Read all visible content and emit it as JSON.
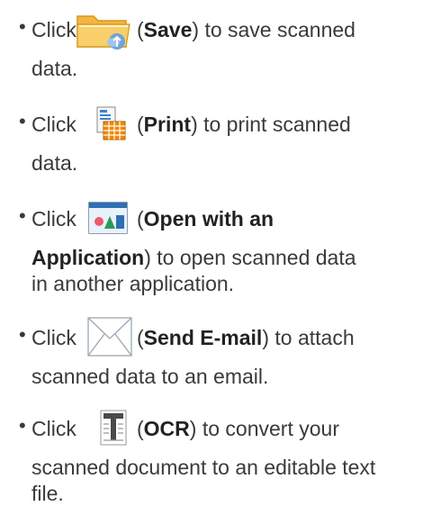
{
  "items": [
    {
      "icon": "save-folder-icon",
      "click": "Click",
      "open_paren": "(",
      "label": "Save",
      "line1_rest": ") to save scanned",
      "line2": "data."
    },
    {
      "icon": "print-icon",
      "click": "Click",
      "open_paren": "(",
      "label": "Print",
      "line1_rest": ") to print scanned",
      "line2": "data."
    },
    {
      "icon": "open-application-icon",
      "click": "Click",
      "open_paren": "(",
      "label_line1": "Open with an",
      "label_line2": "Application",
      "line2_rest": ") to open scanned data",
      "line3": "in another application."
    },
    {
      "icon": "email-envelope-icon",
      "click": "Click",
      "open_paren": "(",
      "label": "Send E-mail",
      "line1_rest": ") to attach",
      "line2": "scanned data to an email."
    },
    {
      "icon": "ocr-text-icon",
      "click": "Click",
      "open_paren": "(",
      "label": "OCR",
      "line1_rest": ") to convert your",
      "line2": "scanned document to an editable text",
      "line3": "file."
    }
  ],
  "colors": {
    "text": "#3a3a3a",
    "folder": "#f2b33d",
    "print_grid": "#f08a00",
    "envelope": "#9aa7b3"
  }
}
